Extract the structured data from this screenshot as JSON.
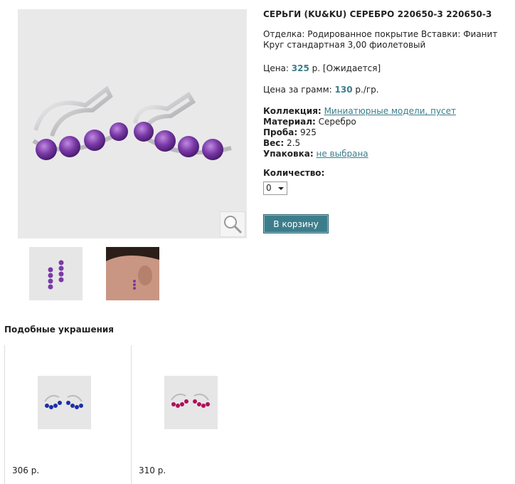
{
  "product": {
    "title": "СЕРЬГИ (KU&KU) СЕРЕБРО 220650-3 220650-3",
    "description": "Отделка: Родированное покрытие Вставки: Фианит Круг стандартная 3,00 фиолетовый",
    "price_label": "Цена:",
    "price_value": "325",
    "price_suffix": "р. [Ожидается]",
    "per_gram_label": "Цена за грамм:",
    "per_gram_value": "130",
    "per_gram_suffix": "р./гр.",
    "collection_label": "Коллекция:",
    "collection_value": "Миниатюрные модели, пусет",
    "material_label": "Материал:",
    "material_value": "Серебро",
    "probe_label": "Проба:",
    "probe_value": "925",
    "weight_label": "Вес:",
    "weight_value": "2.5",
    "packaging_label": "Упаковка:",
    "packaging_value": "не выбрана",
    "quantity_label": "Количество:",
    "quantity_value": "0",
    "cart_button": "В корзину"
  },
  "similar": {
    "title": "Подобные украшения",
    "items": [
      {
        "price": "306 р.",
        "stone_color": "#1b2fa8"
      },
      {
        "price": "310 р.",
        "stone_color": "#b0105a"
      }
    ]
  },
  "colors": {
    "accent": "#3c7d8c",
    "amethyst": "#7a3aa8"
  }
}
